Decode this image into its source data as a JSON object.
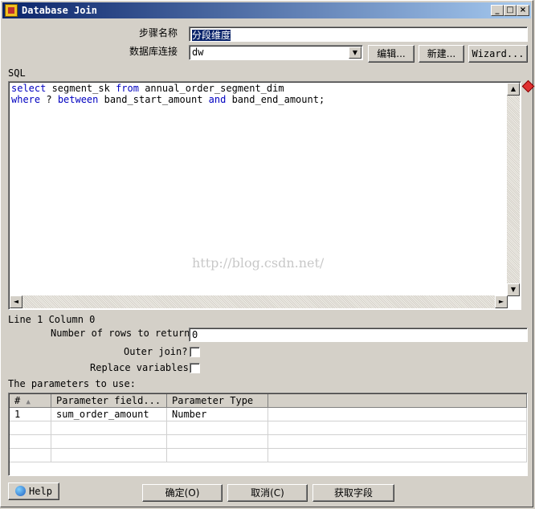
{
  "window": {
    "title": "Database Join"
  },
  "step_name": {
    "label": "步骤名称",
    "value": "分段维度"
  },
  "db_connection": {
    "label": "数据库连接",
    "value": "dw",
    "edit_label": "编辑...",
    "new_label": "新建...",
    "wizard_label": "Wizard..."
  },
  "sql": {
    "label": "SQL",
    "line1": {
      "kw1": "select",
      "t1": " segment_sk ",
      "kw2": "from",
      "t2": " annual_order_segment_dim"
    },
    "line2": {
      "kw1": "where",
      "t1": " ? ",
      "kw2": "between",
      "t2": " band_start_amount ",
      "kw3": "and",
      "t3": " band_end_amount;"
    },
    "watermark": "http://blog.csdn.net/"
  },
  "status": {
    "position": "Line 1 Column 0"
  },
  "options": {
    "rows_label": "Number of rows to return",
    "rows_value": "0",
    "outer_join_label": "Outer join?",
    "replace_vars_label": "Replace variables"
  },
  "params": {
    "label": "The parameters to use:",
    "columns": [
      "#",
      "Parameter field...",
      "Parameter Type"
    ],
    "rows": [
      {
        "num": "1",
        "field": "sum_order_amount",
        "type": "Number"
      }
    ]
  },
  "buttons": {
    "help": "Help",
    "ok": "确定(O)",
    "cancel": "取消(C)",
    "get_fields": "获取字段"
  },
  "colors": {
    "title_start": "#0a246a",
    "title_end": "#a6caf0",
    "keyword": "#0000c0",
    "face": "#d4d0c8"
  }
}
